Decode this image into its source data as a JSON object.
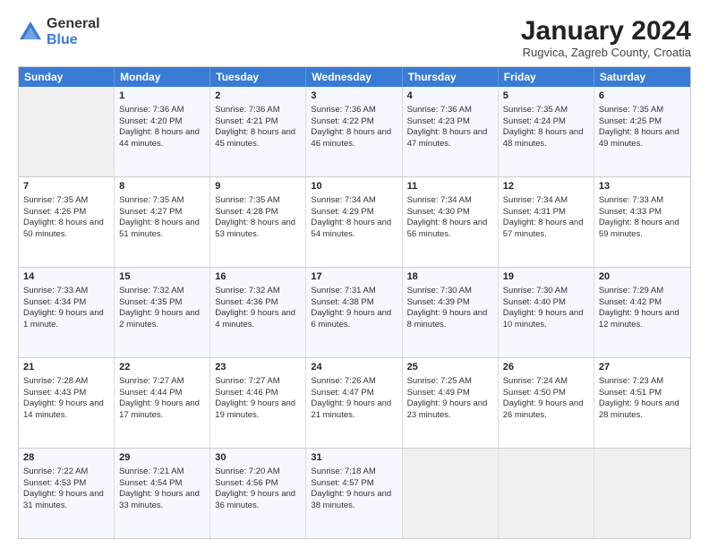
{
  "header": {
    "logo": {
      "general": "General",
      "blue": "Blue"
    },
    "title": "January 2024",
    "subtitle": "Rugvica, Zagreb County, Croatia"
  },
  "calendar": {
    "days": [
      "Sunday",
      "Monday",
      "Tuesday",
      "Wednesday",
      "Thursday",
      "Friday",
      "Saturday"
    ],
    "weeks": [
      [
        {
          "empty": true
        },
        {
          "date": "1",
          "sunrise": "7:36 AM",
          "sunset": "4:20 PM",
          "daylight": "8 hours and 44 minutes."
        },
        {
          "date": "2",
          "sunrise": "7:36 AM",
          "sunset": "4:21 PM",
          "daylight": "8 hours and 45 minutes."
        },
        {
          "date": "3",
          "sunrise": "7:36 AM",
          "sunset": "4:22 PM",
          "daylight": "8 hours and 46 minutes."
        },
        {
          "date": "4",
          "sunrise": "7:36 AM",
          "sunset": "4:23 PM",
          "daylight": "8 hours and 47 minutes."
        },
        {
          "date": "5",
          "sunrise": "7:35 AM",
          "sunset": "4:24 PM",
          "daylight": "8 hours and 48 minutes."
        },
        {
          "date": "6",
          "sunrise": "7:35 AM",
          "sunset": "4:25 PM",
          "daylight": "8 hours and 49 minutes."
        }
      ],
      [
        {
          "date": "7",
          "sunrise": "7:35 AM",
          "sunset": "4:26 PM",
          "daylight": "8 hours and 50 minutes.",
          "week": true
        },
        {
          "date": "8",
          "sunrise": "7:35 AM",
          "sunset": "4:27 PM",
          "daylight": "8 hours and 51 minutes."
        },
        {
          "date": "9",
          "sunrise": "7:35 AM",
          "sunset": "4:28 PM",
          "daylight": "8 hours and 53 minutes."
        },
        {
          "date": "10",
          "sunrise": "7:34 AM",
          "sunset": "4:29 PM",
          "daylight": "8 hours and 54 minutes."
        },
        {
          "date": "11",
          "sunrise": "7:34 AM",
          "sunset": "4:30 PM",
          "daylight": "8 hours and 56 minutes."
        },
        {
          "date": "12",
          "sunrise": "7:34 AM",
          "sunset": "4:31 PM",
          "daylight": "8 hours and 57 minutes."
        },
        {
          "date": "13",
          "sunrise": "7:33 AM",
          "sunset": "4:33 PM",
          "daylight": "8 hours and 59 minutes."
        }
      ],
      [
        {
          "date": "14",
          "sunrise": "7:33 AM",
          "sunset": "4:34 PM",
          "daylight": "9 hours and 1 minute.",
          "week": true
        },
        {
          "date": "15",
          "sunrise": "7:32 AM",
          "sunset": "4:35 PM",
          "daylight": "9 hours and 2 minutes."
        },
        {
          "date": "16",
          "sunrise": "7:32 AM",
          "sunset": "4:36 PM",
          "daylight": "9 hours and 4 minutes."
        },
        {
          "date": "17",
          "sunrise": "7:31 AM",
          "sunset": "4:38 PM",
          "daylight": "9 hours and 6 minutes."
        },
        {
          "date": "18",
          "sunrise": "7:30 AM",
          "sunset": "4:39 PM",
          "daylight": "9 hours and 8 minutes."
        },
        {
          "date": "19",
          "sunrise": "7:30 AM",
          "sunset": "4:40 PM",
          "daylight": "9 hours and 10 minutes."
        },
        {
          "date": "20",
          "sunrise": "7:29 AM",
          "sunset": "4:42 PM",
          "daylight": "9 hours and 12 minutes."
        }
      ],
      [
        {
          "date": "21",
          "sunrise": "7:28 AM",
          "sunset": "4:43 PM",
          "daylight": "9 hours and 14 minutes.",
          "week": true
        },
        {
          "date": "22",
          "sunrise": "7:27 AM",
          "sunset": "4:44 PM",
          "daylight": "9 hours and 17 minutes."
        },
        {
          "date": "23",
          "sunrise": "7:27 AM",
          "sunset": "4:46 PM",
          "daylight": "9 hours and 19 minutes."
        },
        {
          "date": "24",
          "sunrise": "7:26 AM",
          "sunset": "4:47 PM",
          "daylight": "9 hours and 21 minutes."
        },
        {
          "date": "25",
          "sunrise": "7:25 AM",
          "sunset": "4:49 PM",
          "daylight": "9 hours and 23 minutes."
        },
        {
          "date": "26",
          "sunrise": "7:24 AM",
          "sunset": "4:50 PM",
          "daylight": "9 hours and 26 minutes."
        },
        {
          "date": "27",
          "sunrise": "7:23 AM",
          "sunset": "4:51 PM",
          "daylight": "9 hours and 28 minutes."
        }
      ],
      [
        {
          "date": "28",
          "sunrise": "7:22 AM",
          "sunset": "4:53 PM",
          "daylight": "9 hours and 31 minutes.",
          "week": true
        },
        {
          "date": "29",
          "sunrise": "7:21 AM",
          "sunset": "4:54 PM",
          "daylight": "9 hours and 33 minutes."
        },
        {
          "date": "30",
          "sunrise": "7:20 AM",
          "sunset": "4:56 PM",
          "daylight": "9 hours and 36 minutes."
        },
        {
          "date": "31",
          "sunrise": "7:18 AM",
          "sunset": "4:57 PM",
          "daylight": "9 hours and 38 minutes."
        },
        {
          "empty": true
        },
        {
          "empty": true
        },
        {
          "empty": true
        }
      ]
    ]
  },
  "labels": {
    "sunrise_prefix": "Sunrise: ",
    "sunset_prefix": "Sunset: ",
    "daylight_prefix": "Daylight: "
  }
}
